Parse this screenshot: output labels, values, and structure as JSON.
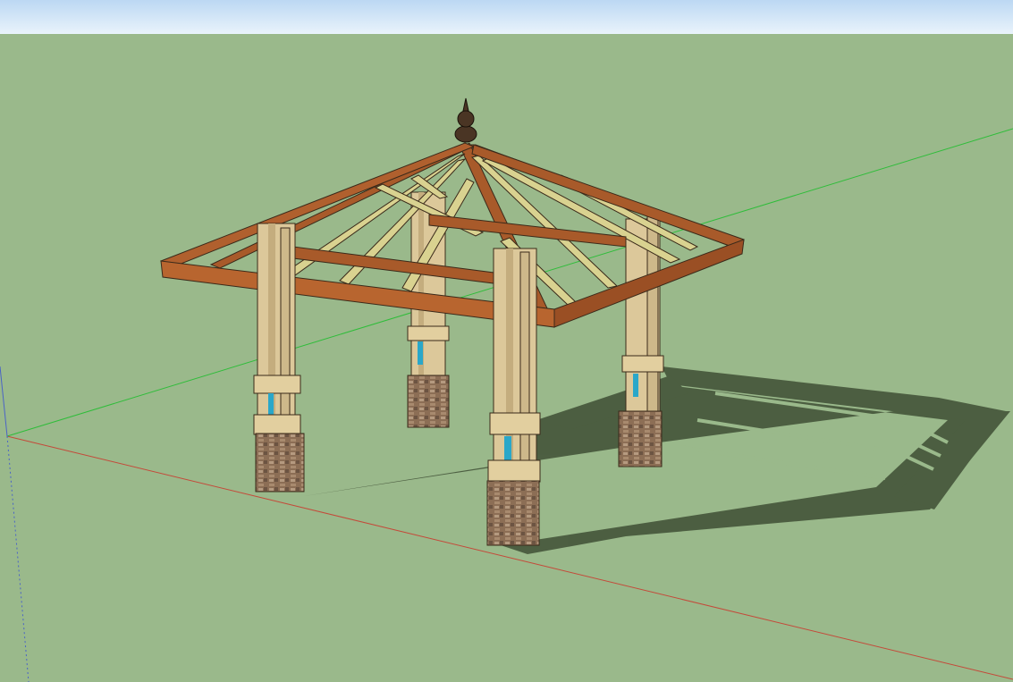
{
  "scene": {
    "sky_colors": [
      "#bcd8f3",
      "#e9f3fb"
    ],
    "ground_color": "#9ab98b",
    "axes": {
      "red": "#c44a3a",
      "green": "#2fbd3a",
      "blue": "#4a63c7"
    },
    "model": {
      "type": "hip-roof gazebo",
      "posts": 4,
      "finial": true,
      "materials": {
        "beam": "#a85a2a",
        "rafter": "#d9d290",
        "post": "#dcc89a",
        "stone": "#8c6e55",
        "accent": "#2aa7c9"
      }
    }
  }
}
